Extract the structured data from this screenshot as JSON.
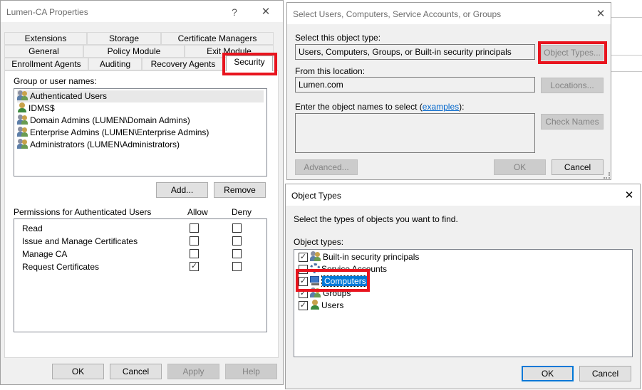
{
  "colors": {
    "accent": "#0078d7",
    "highlight": "#e8141e"
  },
  "props": {
    "title": "Lumen-CA Properties",
    "help_glyph": "?",
    "close_glyph": "✕",
    "tabs": {
      "row1": [
        "Extensions",
        "Storage",
        "Certificate Managers"
      ],
      "row2": [
        "General",
        "Policy Module",
        "Exit Module"
      ],
      "row3": [
        "Enrollment Agents",
        "Auditing",
        "Recovery Agents",
        "Security"
      ]
    },
    "group_label": "Group or user names:",
    "principals": [
      {
        "name": "Authenticated Users",
        "icon": "users-icon"
      },
      {
        "name": "IDMS$",
        "icon": "user-icon"
      },
      {
        "name": "Domain Admins (LUMEN\\Domain Admins)",
        "icon": "users-icon"
      },
      {
        "name": "Enterprise Admins (LUMEN\\Enterprise Admins)",
        "icon": "users-icon"
      },
      {
        "name": "Administrators (LUMEN\\Administrators)",
        "icon": "users-icon"
      }
    ],
    "add_label": "Add...",
    "remove_label": "Remove",
    "perm_label": "Permissions for Authenticated Users",
    "allow_label": "Allow",
    "deny_label": "Deny",
    "permissions": [
      {
        "name": "Read",
        "allow": false,
        "deny": false
      },
      {
        "name": "Issue and Manage Certificates",
        "allow": false,
        "deny": false
      },
      {
        "name": "Manage CA",
        "allow": false,
        "deny": false
      },
      {
        "name": "Request Certificates",
        "allow": true,
        "deny": false
      }
    ],
    "ok": "OK",
    "cancel": "Cancel",
    "apply": "Apply",
    "help": "Help"
  },
  "select": {
    "title": "Select Users, Computers, Service Accounts, or Groups",
    "close_glyph": "✕",
    "type_label": "Select this object type:",
    "type_value": "Users, Computers, Groups, or Built-in security principals",
    "object_types_btn": "Object Types...",
    "location_label": "From this location:",
    "location_value": "Lumen.com",
    "locations_btn": "Locations...",
    "names_label": "Enter the object names to select (",
    "names_link": "examples",
    "names_suffix": "):",
    "check_names_btn": "Check Names",
    "advanced_btn": "Advanced...",
    "ok": "OK",
    "cancel": "Cancel"
  },
  "objtypes": {
    "title": "Object Types",
    "close_glyph": "✕",
    "desc": "Select the types of objects you want to find.",
    "list_label": "Object types:",
    "items": [
      {
        "name": "Built-in security principals",
        "checked": true,
        "icon": "users-icon"
      },
      {
        "name": "Service Accounts",
        "checked": false,
        "icon": "gear-icon"
      },
      {
        "name": "Computers",
        "checked": true,
        "icon": "computer-icon"
      },
      {
        "name": "Groups",
        "checked": true,
        "icon": "users-icon"
      },
      {
        "name": "Users",
        "checked": true,
        "icon": "user-icon"
      }
    ],
    "ok": "OK",
    "cancel": "Cancel"
  }
}
